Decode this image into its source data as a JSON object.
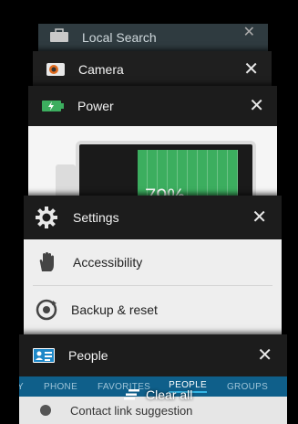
{
  "recents": {
    "back_card": {
      "title": "Local Search"
    },
    "camera": {
      "title": "Camera"
    },
    "power": {
      "title": "Power",
      "battery_percent": "79%",
      "level": 0.79
    },
    "settings": {
      "title": "Settings",
      "items": [
        {
          "label": "Accessibility"
        },
        {
          "label": "Backup & reset"
        }
      ]
    },
    "people": {
      "title": "People",
      "tabs": [
        "Y",
        "PHONE",
        "FAVORITES",
        "PEOPLE",
        "GROUPS"
      ],
      "active_tab": "PEOPLE",
      "partial_item": "Contact link suggestion"
    },
    "clear_all_label": "Clear all",
    "close_glyph": "✕"
  },
  "colors": {
    "card_header": "#1c1c1c",
    "tab_bar": "#0f5f8a",
    "battery_green": "#3cae5f",
    "accent": "#33b5e5"
  },
  "icons": {
    "back_card": "briefcase-icon",
    "camera": "camera-icon",
    "power": "battery-charging-icon",
    "settings": "gear-icon",
    "accessibility": "hand-icon",
    "backup": "backup-restore-icon",
    "people": "contact-card-icon",
    "clear_all": "clear-all-icon"
  }
}
